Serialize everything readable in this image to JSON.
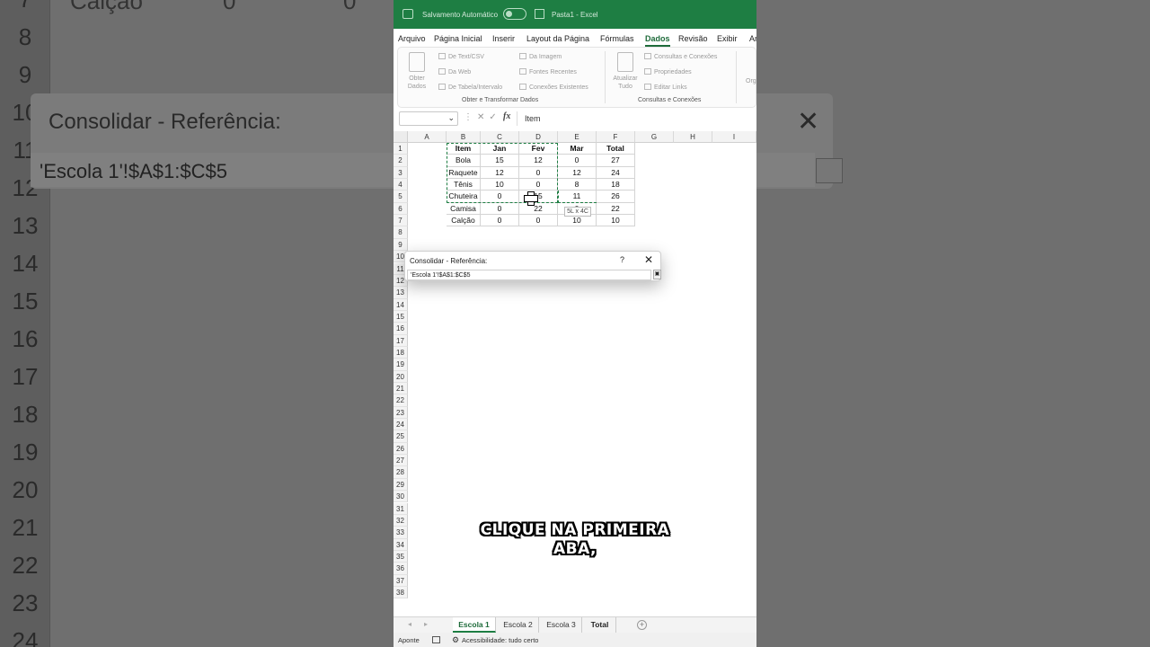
{
  "titlebar": {
    "autosave_label": "Salvamento Automático",
    "filename": "Pasta1 - Excel"
  },
  "menu": {
    "items": [
      "Arquivo",
      "Página Inicial",
      "Inserir",
      "Layout da Página",
      "Fórmulas",
      "Dados",
      "Revisão",
      "Exibir",
      "Ar"
    ],
    "active": "Dados"
  },
  "ribbon": {
    "obter_dados": "Obter Dados",
    "de_text_csv": "De Text/CSV",
    "da_web": "Da Web",
    "de_tabela": "De Tabela/Intervalo",
    "da_imagem": "Da Imagem",
    "fontes_recentes": "Fontes Recentes",
    "conexoes_existentes": "Conexões Existentes",
    "group_obter": "Obter e Transformar Dados",
    "atualizar_tudo": "Atualizar Tudo",
    "consultas_conexoes": "Consultas e Conexões",
    "propriedades": "Propriedades",
    "editar_links": "Editar Links",
    "group_consultas": "Consultas e Conexões",
    "org": "Org"
  },
  "formula_bar": {
    "fx": "fx",
    "content": "Item"
  },
  "grid": {
    "columns": [
      "A",
      "B",
      "C",
      "D",
      "E",
      "F",
      "G",
      "H",
      "I"
    ],
    "rows": [
      "1",
      "2",
      "3",
      "4",
      "5",
      "6",
      "7",
      "8",
      "9",
      "10",
      "11",
      "12",
      "13",
      "14",
      "15",
      "16",
      "17",
      "18",
      "19",
      "20",
      "21",
      "22",
      "23",
      "24",
      "25",
      "26",
      "27",
      "28",
      "29",
      "30",
      "31",
      "32",
      "33",
      "34",
      "35",
      "36",
      "37",
      "38"
    ],
    "table": [
      [
        "Item",
        "Jan",
        "Fev",
        "Mar",
        "Total"
      ],
      [
        "Bola",
        "15",
        "12",
        "0",
        "27"
      ],
      [
        "Raquete",
        "12",
        "0",
        "12",
        "24"
      ],
      [
        "Tênis",
        "10",
        "0",
        "8",
        "18"
      ],
      [
        "Chuteira",
        "0",
        "15",
        "11",
        "26"
      ],
      [
        "Camisa",
        "0",
        "22",
        "0",
        "22"
      ],
      [
        "Calção",
        "0",
        "0",
        "10",
        "10"
      ]
    ],
    "size_tip": "5L x 4C"
  },
  "dialog": {
    "title": "Consolidar - Referência:",
    "help": "?",
    "close": "✕",
    "value": "'Escola 1'!$A$1:$C$5"
  },
  "caption": {
    "line1": "CLIQUE NA PRIMEIRA",
    "line2": "ABA,"
  },
  "sheets": {
    "tabs": [
      "Escola 1",
      "Escola 2",
      "Escola 3",
      "Total"
    ],
    "active": "Escola 1"
  },
  "status": {
    "mode": "Aponte",
    "accessibility": "Acessibilidade: tudo certo"
  },
  "background": {
    "row_numbers": [
      "7",
      "8",
      "9",
      "10",
      "11",
      "12",
      "13",
      "14",
      "15",
      "16",
      "17",
      "18",
      "19",
      "20",
      "21",
      "22",
      "23",
      "24"
    ],
    "top_text": "Calção",
    "top_values": [
      "0",
      "0"
    ],
    "dialog_title": "Consolidar - Referência:",
    "dialog_value": "'Escola 1'!$A$1:$C$5"
  },
  "colors": {
    "excel_green": "#1e7e43",
    "active_tab_green": "#1e6b3a"
  }
}
